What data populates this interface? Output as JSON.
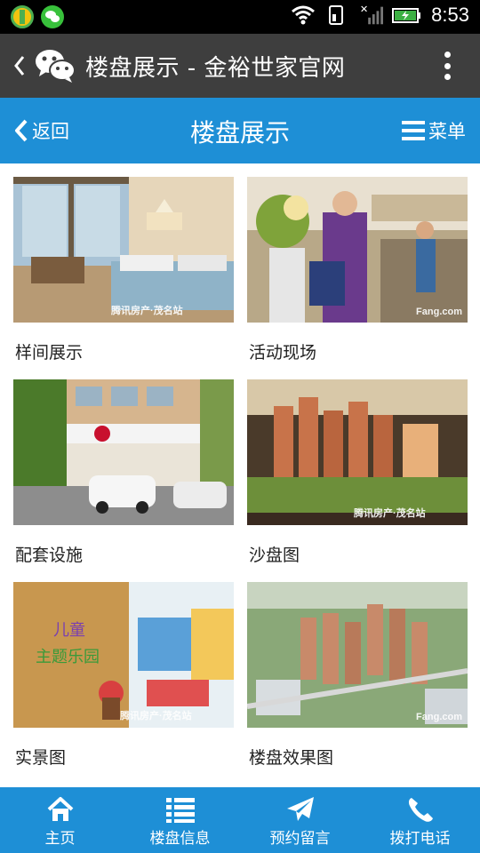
{
  "status_bar": {
    "time": "8:53"
  },
  "app_bar": {
    "title": "楼盘展示 - 金裕世家官网"
  },
  "page_header": {
    "back_label": "返回",
    "title": "楼盘展示",
    "menu_label": "菜单"
  },
  "gallery": [
    {
      "caption": "样间展示",
      "watermark": "腾讯房产·茂名站"
    },
    {
      "caption": "活动现场",
      "watermark": "Fang.com"
    },
    {
      "caption": "配套设施",
      "watermark": ""
    },
    {
      "caption": "沙盘图",
      "watermark": "腾讯房产·茂名站"
    },
    {
      "caption": "实景图",
      "watermark": "腾讯房产·茂名站"
    },
    {
      "caption": "楼盘效果图",
      "watermark": "Fang.com"
    }
  ],
  "bottom_nav": [
    {
      "label": "主页",
      "icon": "home-icon"
    },
    {
      "label": "楼盘信息",
      "icon": "list-icon"
    },
    {
      "label": "预约留言",
      "icon": "paper-plane-icon"
    },
    {
      "label": "拨打电话",
      "icon": "phone-icon"
    }
  ],
  "colors": {
    "accent": "#1e8fd6",
    "app_bar": "#3e3e3e",
    "status_bar": "#000000"
  }
}
